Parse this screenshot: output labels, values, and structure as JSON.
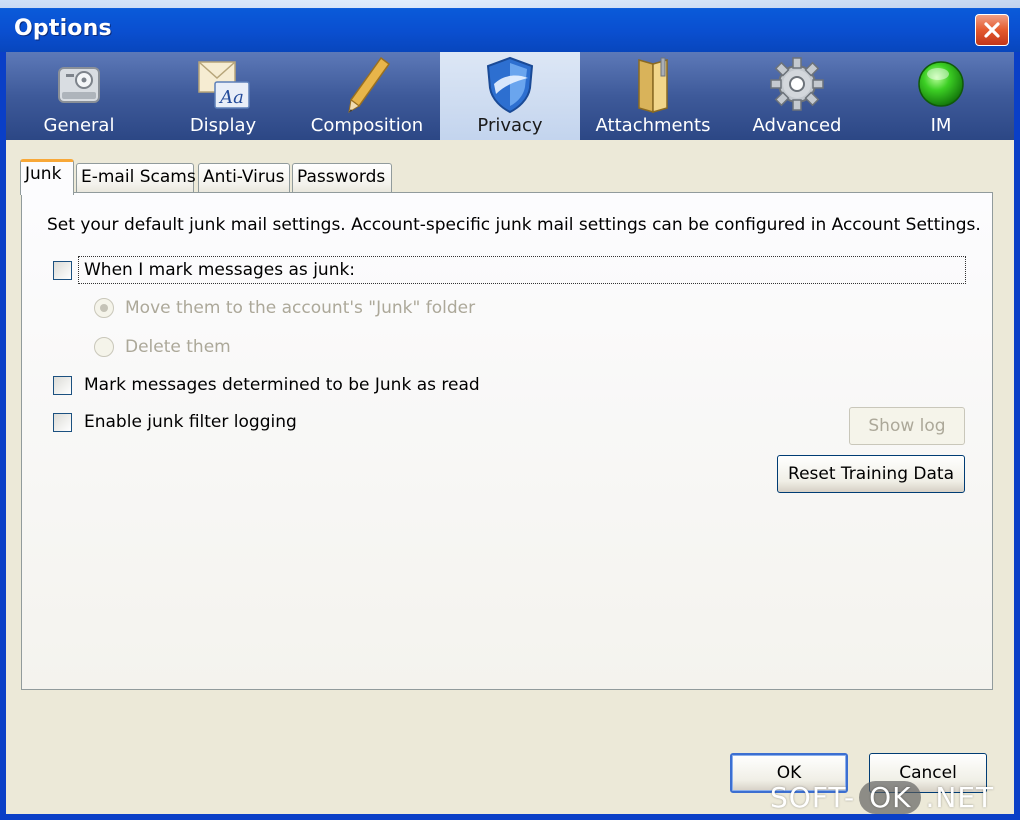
{
  "window": {
    "title": "Options",
    "close_icon": "close-icon"
  },
  "toolbar": {
    "items": [
      {
        "label": "General",
        "icon": "general-icon",
        "selected": false
      },
      {
        "label": "Display",
        "icon": "display-icon",
        "selected": false
      },
      {
        "label": "Composition",
        "icon": "pencil-icon",
        "selected": false
      },
      {
        "label": "Privacy",
        "icon": "shield-icon",
        "selected": true
      },
      {
        "label": "Attachments",
        "icon": "folder-icon",
        "selected": false
      },
      {
        "label": "Advanced",
        "icon": "gear-icon",
        "selected": false
      },
      {
        "label": "IM",
        "icon": "status-dot-icon",
        "selected": false
      }
    ]
  },
  "tabs": [
    {
      "label": "Junk",
      "active": true
    },
    {
      "label": "E-mail Scams",
      "active": false
    },
    {
      "label": "Anti-Virus",
      "active": false
    },
    {
      "label": "Passwords",
      "active": false
    }
  ],
  "junk": {
    "description": "Set your default junk mail settings. Account-specific junk mail settings can be configured in Account Settings.",
    "mark_as_junk_label": "When I mark messages as junk:",
    "mark_as_junk_checked": false,
    "move_option_label": "Move them to the account's \"Junk\" folder",
    "move_option_selected": true,
    "delete_option_label": "Delete them",
    "delete_option_selected": false,
    "mark_read_label": "Mark messages determined to be Junk as read",
    "mark_read_checked": false,
    "logging_label": "Enable junk filter logging",
    "logging_checked": false,
    "show_log_label": "Show log",
    "reset_label": "Reset Training Data"
  },
  "footer": {
    "ok_label": "OK",
    "cancel_label": "Cancel"
  },
  "watermark": {
    "part1": "SOFT-",
    "part2": "OK",
    "part3": ".NET"
  },
  "colors": {
    "titlebar": "#0a4fd0",
    "toolbar": "#3e5a9a",
    "selected_tool": "#c3d4ee",
    "dialog_bg": "#ece9d8",
    "tab_highlight": "#f8a838"
  }
}
